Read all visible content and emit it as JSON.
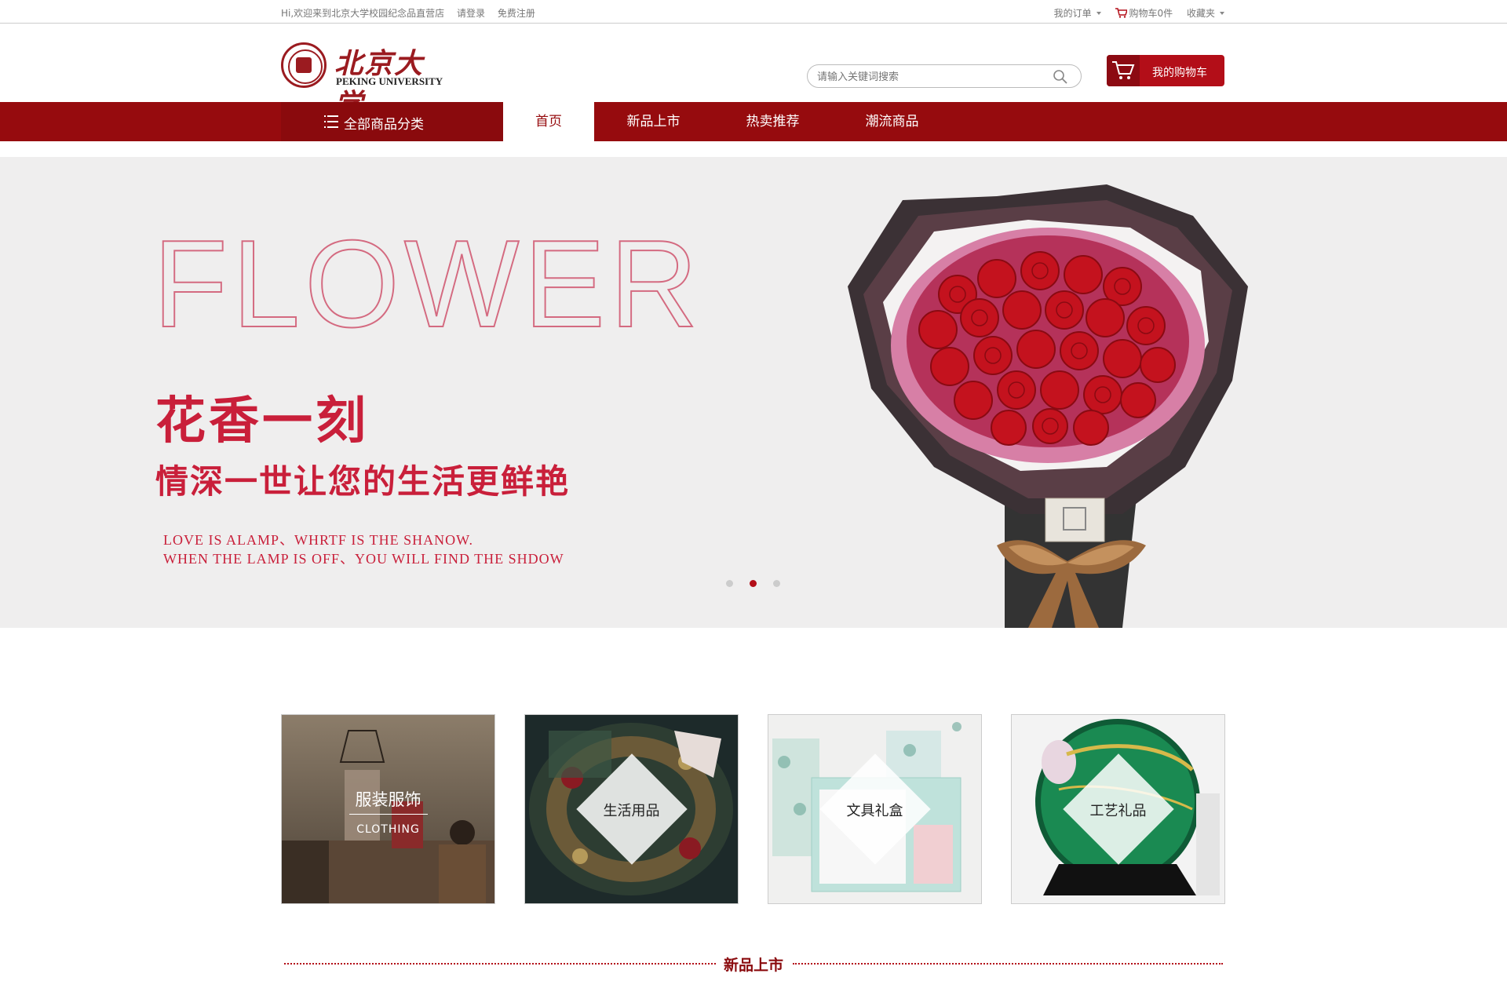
{
  "topbar": {
    "welcome": "Hi,欢迎来到北京大学校园纪念品直营店",
    "login": "请登录",
    "register": "免费注册",
    "orders": "我的订单",
    "cart": "购物车0件",
    "favorites": "收藏夹"
  },
  "header": {
    "logo_cn": "北京大学",
    "logo_en": "PEKING UNIVERSITY",
    "search_placeholder": "请输入关键词搜索",
    "cart_button": "我的购物车"
  },
  "nav": {
    "all_categories": "全部商品分类",
    "items": [
      {
        "label": "首页",
        "active": true
      },
      {
        "label": "新品上市",
        "active": false
      },
      {
        "label": "热卖推荐",
        "active": false
      },
      {
        "label": "潮流商品",
        "active": false
      }
    ],
    "bar_color": "#960b0e"
  },
  "banner": {
    "headline_en": "FLOWER",
    "headline_cn": "花香一刻",
    "subline_cn": "情深一世让您的生活更鲜艳",
    "line_en_1": "LOVE IS ALAMP、WHRTF IS THE SHANOW.",
    "line_en_2": "WHEN THE LAMP IS OFF、YOU WILL FIND THE SHDOW",
    "slides": 3,
    "active_slide": 2,
    "accent_color": "#c91f3a"
  },
  "categories": [
    {
      "label": "服装服饰",
      "sub": "CLOTHING"
    },
    {
      "label": "生活用品"
    },
    {
      "label": "文具礼盒"
    },
    {
      "label": "工艺礼品"
    }
  ],
  "section": {
    "title": "新品上市"
  }
}
